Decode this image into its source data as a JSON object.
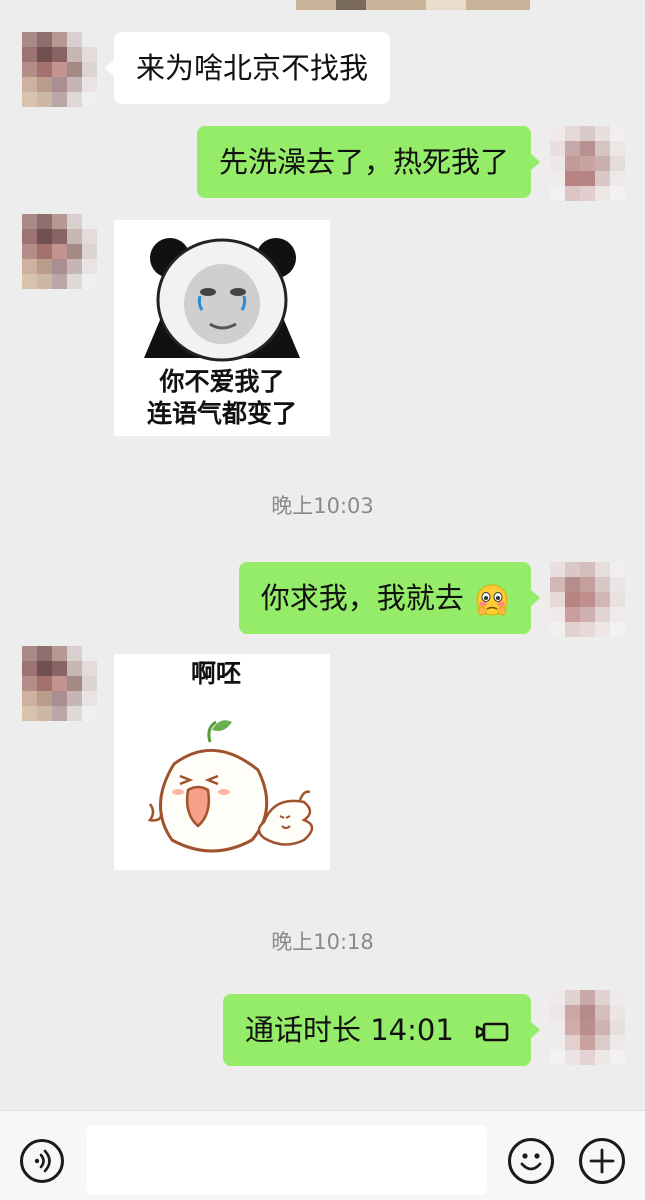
{
  "messages": {
    "m1_text": "来为啥北京不找我",
    "m2_text": "先洗澡去了，热死我了",
    "m3_sticker_caption_line1": "你不爱我了",
    "m3_sticker_caption_line2": "连语气都变了",
    "time1": "晚上10:03",
    "m4_text": "你求我，我就去",
    "m4_emoji": "flushed-pleading-emoji",
    "m5_sticker_caption": "啊呸",
    "time2": "晚上10:18",
    "m6_call_label": "通话时长 14:01",
    "m6_icon": "video-call-icon"
  },
  "input_bar": {
    "voice_icon": "voice-icon",
    "emoji_icon": "smiley-icon",
    "more_icon": "plus-icon",
    "input_value": ""
  },
  "colors": {
    "background": "#ededed",
    "incoming_bubble": "#ffffff",
    "outgoing_bubble": "#95ec69",
    "timestamp": "#8a8a8a"
  }
}
